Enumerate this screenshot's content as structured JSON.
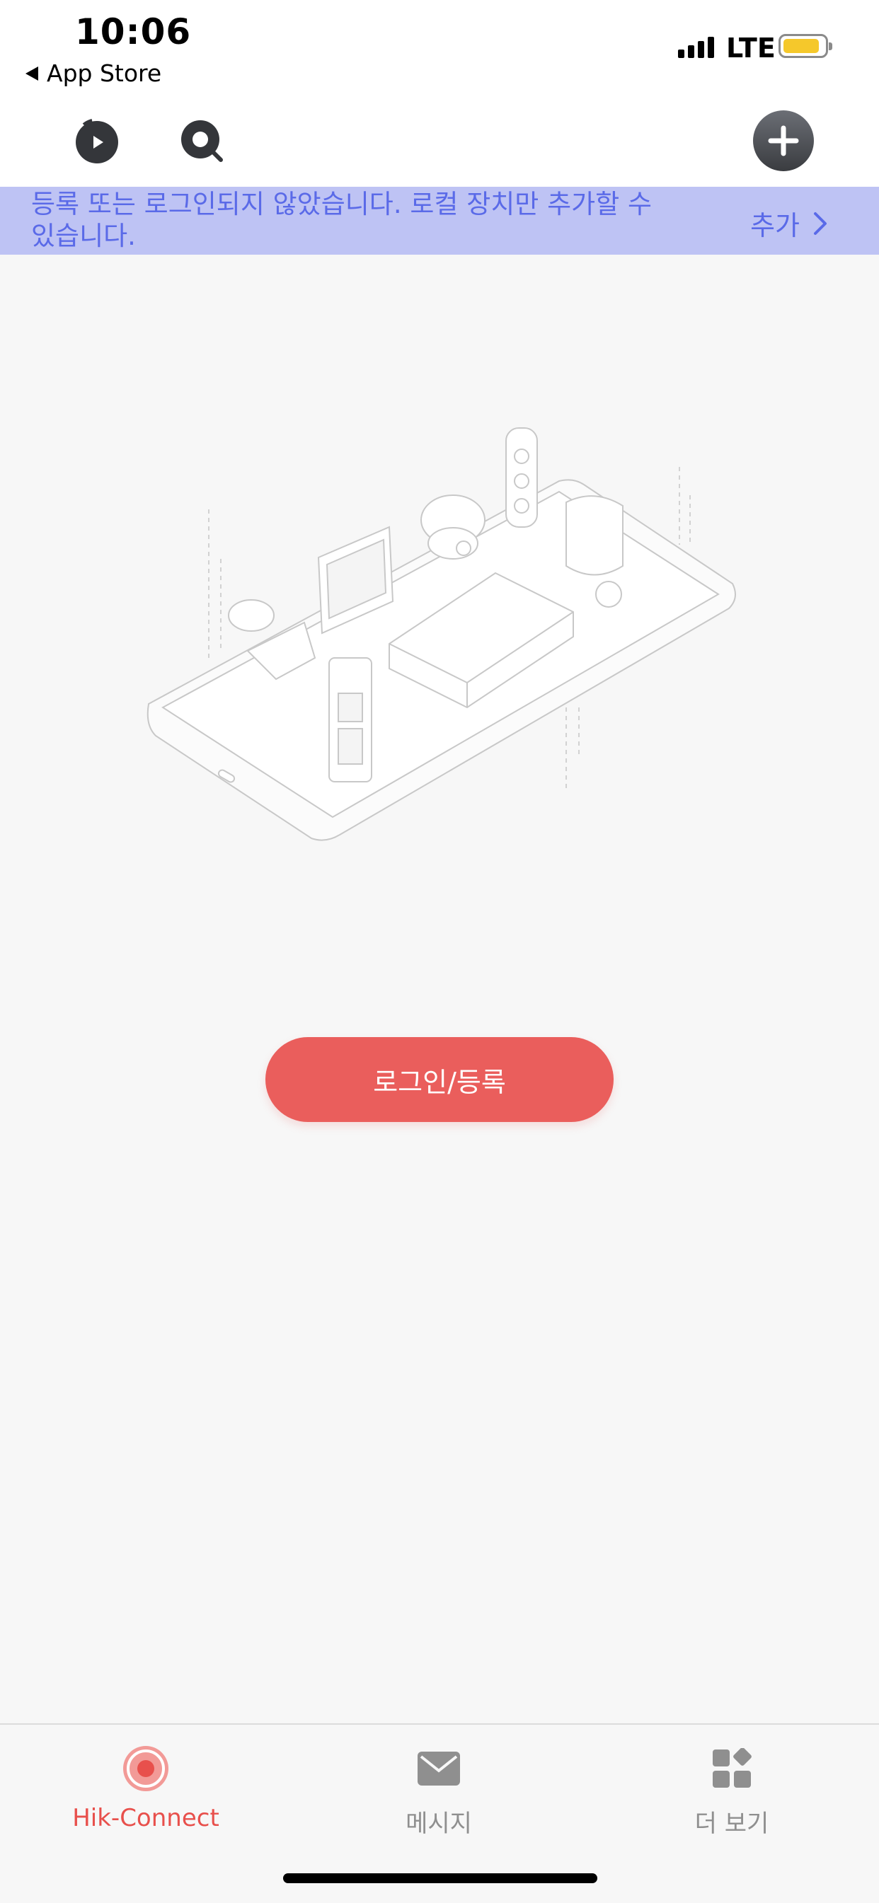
{
  "status_bar": {
    "time": "10:06",
    "back_label": "App Store",
    "network": "LTE",
    "battery_level": 0.9,
    "battery_color": "#f5c82b"
  },
  "toolbar": {
    "play_icon": "play-circle-icon",
    "search_icon": "search-icon",
    "add_icon": "plus-icon"
  },
  "banner": {
    "message": "등록 또는 로그인되지 않았습니다. 로컬 장치만 추가할 수 있습니다.",
    "action_label": "추가",
    "background": "#bec3f4",
    "text_color": "#5a6ae8"
  },
  "main": {
    "illustration": "devices-on-phone-illustration",
    "login_button_label": "로그인/등록",
    "login_button_color": "#ea5e5c"
  },
  "tabs": [
    {
      "label": "Hik-Connect",
      "icon": "hik-connect-icon",
      "active": true
    },
    {
      "label": "메시지",
      "icon": "envelope-icon",
      "active": false
    },
    {
      "label": "더 보기",
      "icon": "more-grid-icon",
      "active": false
    }
  ],
  "colors": {
    "accent": "#e8504c",
    "inactive": "#8f8f8f"
  }
}
